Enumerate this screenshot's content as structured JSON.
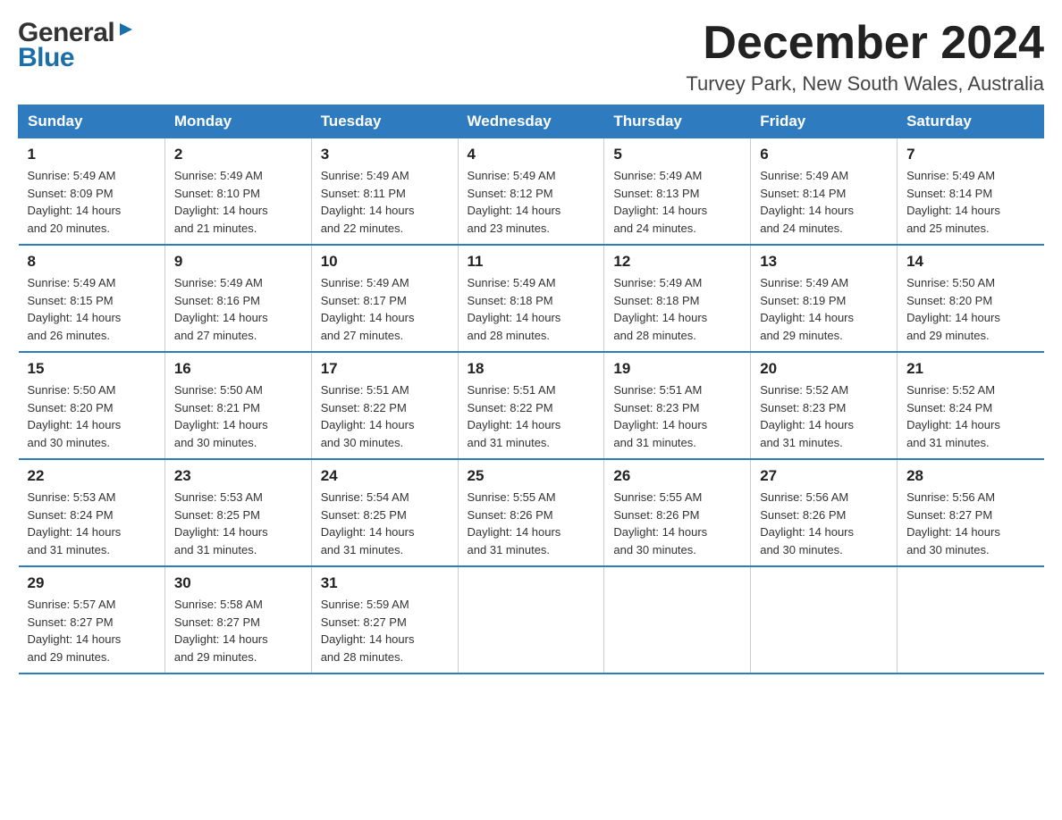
{
  "logo": {
    "text_general": "General",
    "text_blue": "Blue",
    "arrow_symbol": "▶"
  },
  "header": {
    "month_year": "December 2024",
    "location": "Turvey Park, New South Wales, Australia"
  },
  "weekdays": [
    "Sunday",
    "Monday",
    "Tuesday",
    "Wednesday",
    "Thursday",
    "Friday",
    "Saturday"
  ],
  "weeks": [
    [
      {
        "day": "1",
        "sunrise": "5:49 AM",
        "sunset": "8:09 PM",
        "daylight": "14 hours and 20 minutes."
      },
      {
        "day": "2",
        "sunrise": "5:49 AM",
        "sunset": "8:10 PM",
        "daylight": "14 hours and 21 minutes."
      },
      {
        "day": "3",
        "sunrise": "5:49 AM",
        "sunset": "8:11 PM",
        "daylight": "14 hours and 22 minutes."
      },
      {
        "day": "4",
        "sunrise": "5:49 AM",
        "sunset": "8:12 PM",
        "daylight": "14 hours and 23 minutes."
      },
      {
        "day": "5",
        "sunrise": "5:49 AM",
        "sunset": "8:13 PM",
        "daylight": "14 hours and 24 minutes."
      },
      {
        "day": "6",
        "sunrise": "5:49 AM",
        "sunset": "8:14 PM",
        "daylight": "14 hours and 24 minutes."
      },
      {
        "day": "7",
        "sunrise": "5:49 AM",
        "sunset": "8:14 PM",
        "daylight": "14 hours and 25 minutes."
      }
    ],
    [
      {
        "day": "8",
        "sunrise": "5:49 AM",
        "sunset": "8:15 PM",
        "daylight": "14 hours and 26 minutes."
      },
      {
        "day": "9",
        "sunrise": "5:49 AM",
        "sunset": "8:16 PM",
        "daylight": "14 hours and 27 minutes."
      },
      {
        "day": "10",
        "sunrise": "5:49 AM",
        "sunset": "8:17 PM",
        "daylight": "14 hours and 27 minutes."
      },
      {
        "day": "11",
        "sunrise": "5:49 AM",
        "sunset": "8:18 PM",
        "daylight": "14 hours and 28 minutes."
      },
      {
        "day": "12",
        "sunrise": "5:49 AM",
        "sunset": "8:18 PM",
        "daylight": "14 hours and 28 minutes."
      },
      {
        "day": "13",
        "sunrise": "5:49 AM",
        "sunset": "8:19 PM",
        "daylight": "14 hours and 29 minutes."
      },
      {
        "day": "14",
        "sunrise": "5:50 AM",
        "sunset": "8:20 PM",
        "daylight": "14 hours and 29 minutes."
      }
    ],
    [
      {
        "day": "15",
        "sunrise": "5:50 AM",
        "sunset": "8:20 PM",
        "daylight": "14 hours and 30 minutes."
      },
      {
        "day": "16",
        "sunrise": "5:50 AM",
        "sunset": "8:21 PM",
        "daylight": "14 hours and 30 minutes."
      },
      {
        "day": "17",
        "sunrise": "5:51 AM",
        "sunset": "8:22 PM",
        "daylight": "14 hours and 30 minutes."
      },
      {
        "day": "18",
        "sunrise": "5:51 AM",
        "sunset": "8:22 PM",
        "daylight": "14 hours and 31 minutes."
      },
      {
        "day": "19",
        "sunrise": "5:51 AM",
        "sunset": "8:23 PM",
        "daylight": "14 hours and 31 minutes."
      },
      {
        "day": "20",
        "sunrise": "5:52 AM",
        "sunset": "8:23 PM",
        "daylight": "14 hours and 31 minutes."
      },
      {
        "day": "21",
        "sunrise": "5:52 AM",
        "sunset": "8:24 PM",
        "daylight": "14 hours and 31 minutes."
      }
    ],
    [
      {
        "day": "22",
        "sunrise": "5:53 AM",
        "sunset": "8:24 PM",
        "daylight": "14 hours and 31 minutes."
      },
      {
        "day": "23",
        "sunrise": "5:53 AM",
        "sunset": "8:25 PM",
        "daylight": "14 hours and 31 minutes."
      },
      {
        "day": "24",
        "sunrise": "5:54 AM",
        "sunset": "8:25 PM",
        "daylight": "14 hours and 31 minutes."
      },
      {
        "day": "25",
        "sunrise": "5:55 AM",
        "sunset": "8:26 PM",
        "daylight": "14 hours and 31 minutes."
      },
      {
        "day": "26",
        "sunrise": "5:55 AM",
        "sunset": "8:26 PM",
        "daylight": "14 hours and 30 minutes."
      },
      {
        "day": "27",
        "sunrise": "5:56 AM",
        "sunset": "8:26 PM",
        "daylight": "14 hours and 30 minutes."
      },
      {
        "day": "28",
        "sunrise": "5:56 AM",
        "sunset": "8:27 PM",
        "daylight": "14 hours and 30 minutes."
      }
    ],
    [
      {
        "day": "29",
        "sunrise": "5:57 AM",
        "sunset": "8:27 PM",
        "daylight": "14 hours and 29 minutes."
      },
      {
        "day": "30",
        "sunrise": "5:58 AM",
        "sunset": "8:27 PM",
        "daylight": "14 hours and 29 minutes."
      },
      {
        "day": "31",
        "sunrise": "5:59 AM",
        "sunset": "8:27 PM",
        "daylight": "14 hours and 28 minutes."
      },
      null,
      null,
      null,
      null
    ]
  ],
  "labels": {
    "sunrise": "Sunrise:",
    "sunset": "Sunset:",
    "daylight": "Daylight:"
  }
}
